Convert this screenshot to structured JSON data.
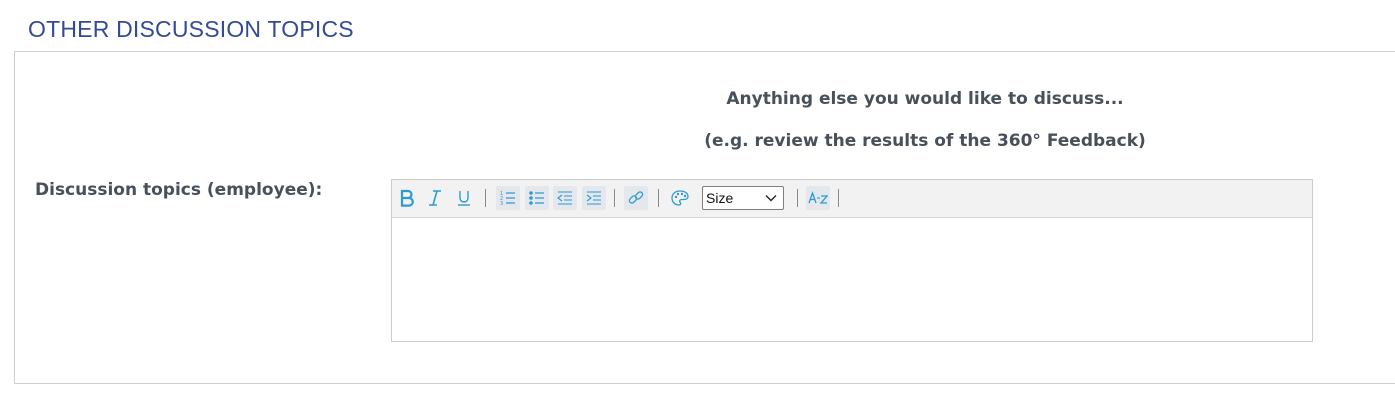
{
  "section": {
    "title": "OTHER DISCUSSION TOPICS"
  },
  "intro": {
    "line1": "Anything else you would like to discuss...",
    "line2": "(e.g. review the results of the 360° Feedback)"
  },
  "field": {
    "label": "Discussion topics (employee):",
    "value": ""
  },
  "toolbar": {
    "buttons": [
      "bold",
      "italic",
      "underline",
      "ordered-list",
      "bullet-list",
      "outdent",
      "indent",
      "link",
      "color-palette",
      "remove-format"
    ],
    "size_select": {
      "selected": "Size"
    }
  },
  "colors": {
    "title": "#354a96",
    "label": "#48505a",
    "icon": "#2b9bd3",
    "toolbar_bg": "#f2f2f2"
  }
}
